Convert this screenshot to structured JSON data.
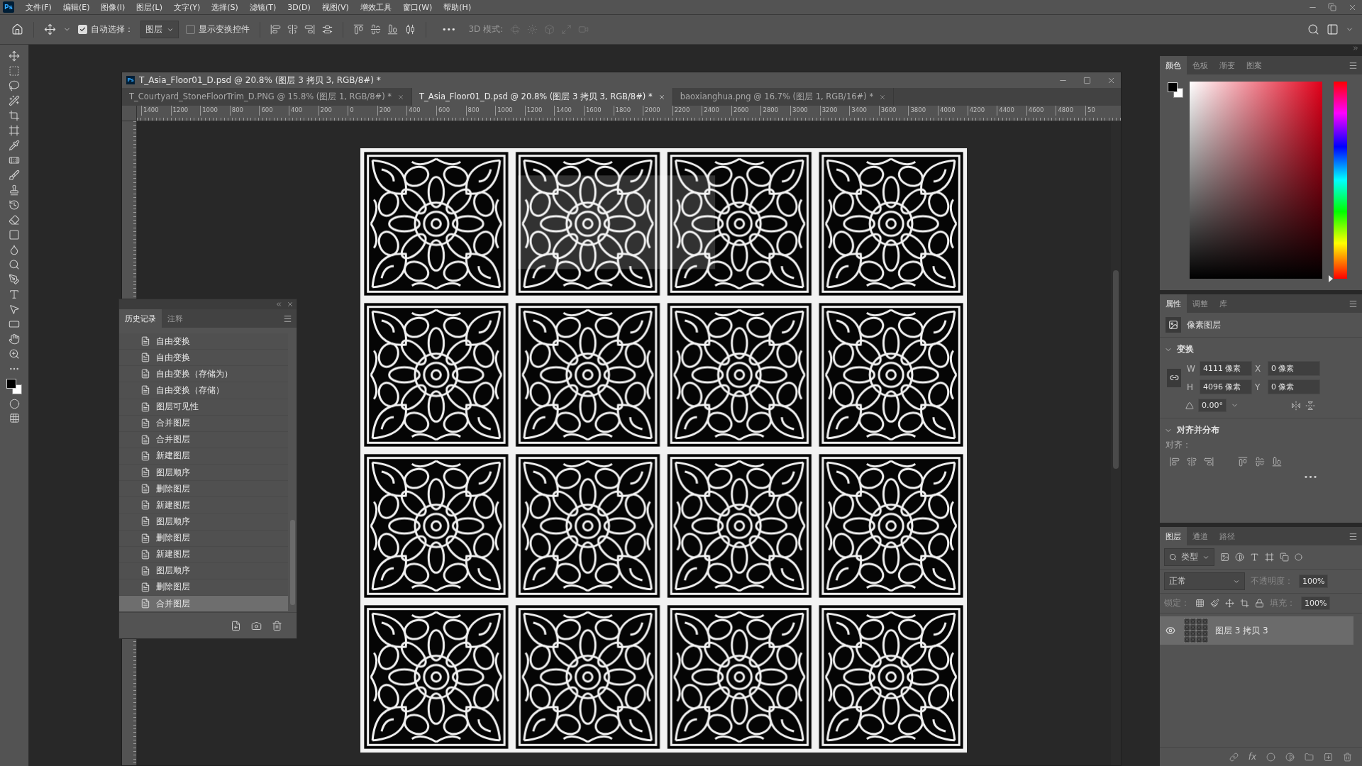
{
  "menu_bar": {
    "logo": "Ps",
    "items": [
      "文件(F)",
      "编辑(E)",
      "图像(I)",
      "图层(L)",
      "文字(Y)",
      "选择(S)",
      "滤镜(T)",
      "3D(D)",
      "视图(V)",
      "增效工具",
      "窗口(W)",
      "帮助(H)"
    ]
  },
  "options_bar": {
    "auto_select": {
      "label": "自动选择：",
      "checked": true
    },
    "auto_select_target": "图层",
    "show_transform": {
      "label": "显示变换控件",
      "checked": false
    },
    "more": "•••",
    "mode_3d": {
      "label": "3D 模式:",
      "disabled": true
    }
  },
  "document": {
    "app_badge": "Ps",
    "title": "T_Asia_Floor01_D.psd @ 20.8% (图层 3 拷贝 3, RGB/8#) *",
    "tabs": [
      {
        "label": "T_Courtyard_StoneFloorTrim_D.PNG @ 15.8% (图层 1, RGB/8#) *",
        "selected": false
      },
      {
        "label": "T_Asia_Floor01_D.psd @ 20.8% (图层 3 拷贝 3, RGB/8#) *",
        "selected": true
      },
      {
        "label": "baoxianghua.png @ 16.7% (图层 1, RGB/16#) *",
        "selected": false
      }
    ],
    "ruler_labels": [
      "1400",
      "1200",
      "1000",
      "800",
      "600",
      "400",
      "200",
      "0",
      "200",
      "400",
      "600",
      "800",
      "1000",
      "1200",
      "1400",
      "1600",
      "1800",
      "2000",
      "2200",
      "2400",
      "2600",
      "2800",
      "3000",
      "3200",
      "3400",
      "3600",
      "3800",
      "4000",
      "4200",
      "4400",
      "4600",
      "4800",
      "50"
    ]
  },
  "history_panel": {
    "tabs": [
      {
        "label": "历史记录",
        "selected": true
      },
      {
        "label": "注释",
        "selected": false
      }
    ],
    "items": [
      {
        "label": "自由变换",
        "selected": false
      },
      {
        "label": "自由变换",
        "selected": false
      },
      {
        "label": "自由变换（存储为）",
        "selected": false
      },
      {
        "label": "自由变换（存储）",
        "selected": false
      },
      {
        "label": "图层可见性",
        "selected": false
      },
      {
        "label": "合并图层",
        "selected": false
      },
      {
        "label": "合并图层",
        "selected": false
      },
      {
        "label": "新建图层",
        "selected": false
      },
      {
        "label": "图层顺序",
        "selected": false
      },
      {
        "label": "删除图层",
        "selected": false
      },
      {
        "label": "新建图层",
        "selected": false
      },
      {
        "label": "图层顺序",
        "selected": false
      },
      {
        "label": "删除图层",
        "selected": false
      },
      {
        "label": "新建图层",
        "selected": false
      },
      {
        "label": "图层顺序",
        "selected": false
      },
      {
        "label": "删除图层",
        "selected": false
      },
      {
        "label": "合并图层",
        "selected": true
      }
    ]
  },
  "color_panel": {
    "hue_slider": {
      "level": 0
    },
    "tabs": [
      {
        "label": "颜色",
        "selected": true
      },
      {
        "label": "色板",
        "selected": false
      },
      {
        "label": "渐变",
        "selected": false
      },
      {
        "label": "图案",
        "selected": false
      }
    ]
  },
  "properties_panel": {
    "tabs": [
      {
        "label": "属性",
        "selected": true
      },
      {
        "label": "调整",
        "selected": false
      },
      {
        "label": "库",
        "selected": false
      }
    ],
    "layer_kind": "像素图层",
    "transform": {
      "title": "变换",
      "expanded": true,
      "w_label": "W",
      "w": "4111 像素",
      "x_label": "X",
      "x": "0 像素",
      "h_label": "H",
      "h": "4096 像素",
      "y_label": "Y",
      "y": "0 像素",
      "angle": "0.00°"
    },
    "align": {
      "title": "对齐并分布",
      "expanded": true,
      "label": "对齐：",
      "more": "•••"
    }
  },
  "layers_panel": {
    "tabs": [
      {
        "label": "图层",
        "selected": true
      },
      {
        "label": "通道",
        "selected": false
      },
      {
        "label": "路径",
        "selected": false
      }
    ],
    "filter": "类型",
    "blend_mode": "正常",
    "opacity_label": "不透明度：",
    "opacity": "100%",
    "lock_label": "锁定：",
    "fill_label": "填充：",
    "fill": "100%",
    "fx_label": "fx",
    "layers": [
      {
        "name": "图层 3 拷贝 3",
        "visible": true,
        "selected": true
      }
    ]
  }
}
